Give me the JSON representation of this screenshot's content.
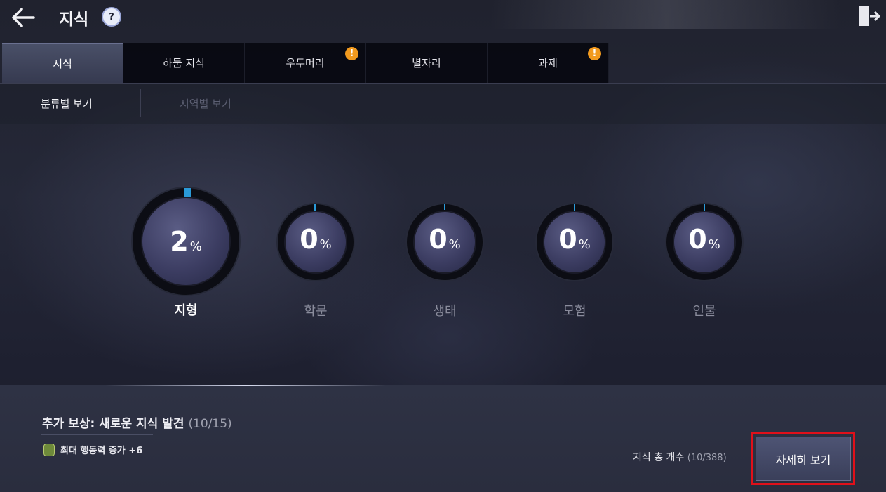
{
  "header": {
    "title": "지식",
    "help_glyph": "?",
    "back_icon": "back-arrow-icon",
    "exit_icon": "exit-icon"
  },
  "tabs": [
    {
      "label": "지식",
      "active": true,
      "alert": false
    },
    {
      "label": "하둠 지식",
      "active": false,
      "alert": false
    },
    {
      "label": "우두머리",
      "active": false,
      "alert": true
    },
    {
      "label": "별자리",
      "active": false,
      "alert": false
    },
    {
      "label": "과제",
      "active": false,
      "alert": true
    }
  ],
  "alert_glyph": "!",
  "subtabs": {
    "by_category": "분류별 보기",
    "by_region": "지역별 보기"
  },
  "categories": [
    {
      "label": "지형",
      "percent": "2",
      "unit": "%",
      "progress": 0.02,
      "selected": true
    },
    {
      "label": "학문",
      "percent": "0",
      "unit": "%",
      "progress": 0.0,
      "selected": false
    },
    {
      "label": "생태",
      "percent": "0",
      "unit": "%",
      "progress": 0.0,
      "selected": false
    },
    {
      "label": "모험",
      "percent": "0",
      "unit": "%",
      "progress": 0.0,
      "selected": false
    },
    {
      "label": "인물",
      "percent": "0",
      "unit": "%",
      "progress": 0.0,
      "selected": false
    }
  ],
  "reward": {
    "title": "추가 보상: 새로운 지식 발견",
    "count": "(10/15)",
    "item": "최대 행동력 증가 +6"
  },
  "total": {
    "label": "지식 총 개수",
    "count": "(10/388)"
  },
  "detail_button": "자세히 보기",
  "colors": {
    "accent_blue": "#2a9ad8",
    "alert_orange": "#f29a1e",
    "highlight_red": "#e0101a"
  }
}
